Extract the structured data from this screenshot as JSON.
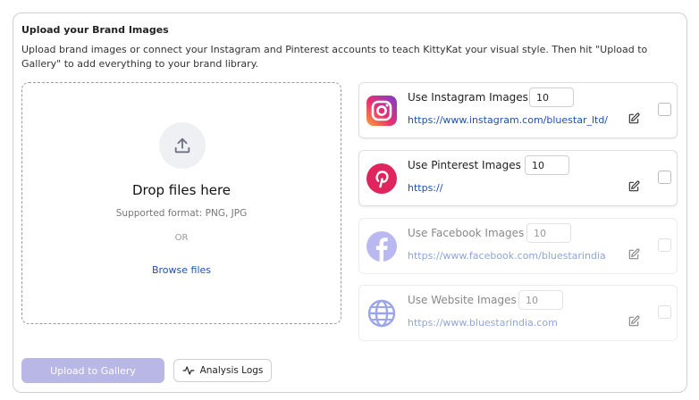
{
  "section": {
    "title": "Upload your Brand Images",
    "description": "Upload brand images or connect your Instagram and Pinterest accounts to teach KittyKat your visual style. Then hit \"Upload to Gallery\" to add everything to your brand library."
  },
  "dropzone": {
    "icon": "upload-icon",
    "title": "Drop files here",
    "supported": "Supported format: PNG, JPG",
    "or": "OR",
    "browse": "Browse files"
  },
  "sources": [
    {
      "name": "instagram",
      "label": "Use Instagram Images",
      "count": "10",
      "url": "https://www.instagram.com/bluestar_ltd/",
      "enabled": true,
      "icon": "instagram-icon"
    },
    {
      "name": "pinterest",
      "label": "Use Pinterest Images",
      "count": "10",
      "url": "https://",
      "enabled": true,
      "icon": "pinterest-icon"
    },
    {
      "name": "facebook",
      "label": "Use Facebook Images",
      "count": "10",
      "url": "https://www.facebook.com/bluestarindia",
      "enabled": false,
      "icon": "facebook-icon"
    },
    {
      "name": "website",
      "label": "Use Website Images",
      "count": "10",
      "url": "https://www.bluestarindia.com",
      "enabled": false,
      "icon": "globe-icon"
    }
  ],
  "actions": {
    "upload": "Upload to Gallery",
    "logs": "Analysis Logs"
  },
  "colors": {
    "link": "#1f4fb3",
    "primary_disabled": "#b8b7e6",
    "pinterest": "#e60023",
    "facebook": "#b9b8f0",
    "globe": "#9aa6e8"
  }
}
